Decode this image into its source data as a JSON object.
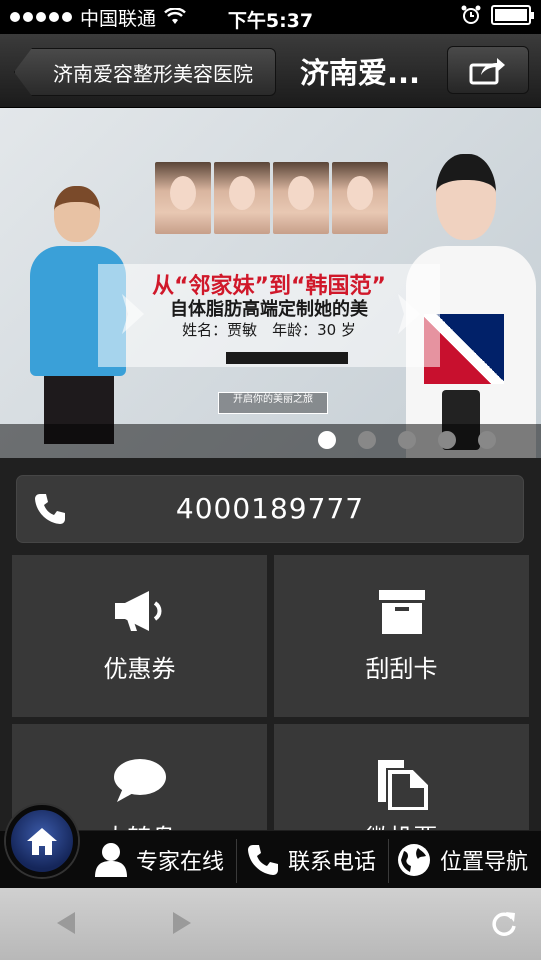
{
  "status_bar": {
    "carrier": "中国联通",
    "time": "下午5:37"
  },
  "header": {
    "back_label": "济南爱容整形美容医院",
    "title": "济南爱..."
  },
  "banner": {
    "headline": "从“邻家妹”到“韩国范”",
    "subline": "自体脂肪高端定制她的美",
    "name_age": "姓名：贾敏　年龄：30 岁",
    "tagline": "开启你的美丽之旅",
    "slide_count": 5,
    "active_slide": 1
  },
  "phone": {
    "number": "4000189777"
  },
  "tiles": [
    {
      "label": "优惠券",
      "icon": "megaphone-icon"
    },
    {
      "label": "刮刮卡",
      "icon": "box-icon"
    },
    {
      "label": "大转盘",
      "icon": "speech-bubble-icon"
    },
    {
      "label": "微投票",
      "icon": "documents-icon"
    }
  ],
  "bottom_nav": [
    {
      "label": "专家在线",
      "icon": "person-icon"
    },
    {
      "label": "联系电话",
      "icon": "phone-icon"
    },
    {
      "label": "位置导航",
      "icon": "globe-icon"
    }
  ]
}
